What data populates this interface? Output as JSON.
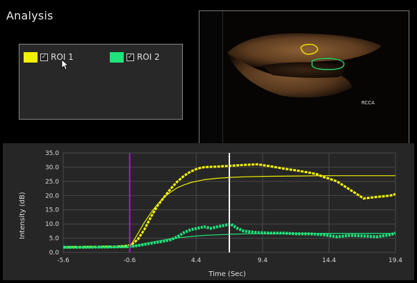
{
  "app": {
    "title": "Analysis"
  },
  "roi_panel": {
    "items": [
      {
        "label": "ROI 1",
        "color": "#f2f200",
        "checked": true
      },
      {
        "label": "ROI 2",
        "color": "#1ee37a",
        "checked": true
      }
    ]
  },
  "ultrasound": {
    "label": "RCCA"
  },
  "colors": {
    "roi1": "#f2f200",
    "roi2": "#1ee37a",
    "marker_injection": "#b012d6",
    "marker_cursor": "#ffffff",
    "grid": "#4a4a4a"
  },
  "chart_data": {
    "type": "line",
    "xlabel": "Time (Sec)",
    "ylabel": "Intensity (dB)",
    "xlim": [
      -5.6,
      19.4
    ],
    "ylim": [
      0,
      35
    ],
    "xticks": [
      "-5.6",
      "-0.6",
      "4.4",
      "9.4",
      "14.4",
      "19.4"
    ],
    "yticks": [
      "0.0",
      "5.0",
      "10.0",
      "15.0",
      "20.0",
      "25.0",
      "30.0",
      "35.0"
    ],
    "grid": true,
    "markers": [
      {
        "name": "injection",
        "x": -0.6
      },
      {
        "name": "cursor",
        "x": 6.9
      }
    ],
    "series": [
      {
        "name": "ROI 1",
        "x": [
          -5.6,
          -4.0,
          -2.0,
          -1.0,
          -0.5,
          0.0,
          0.5,
          1.0,
          1.5,
          2.0,
          2.5,
          3.0,
          3.5,
          4.0,
          4.5,
          5.0,
          6.0,
          7.0,
          8.0,
          9.0,
          10.0,
          11.0,
          12.0,
          13.0,
          13.5,
          14.0,
          14.4,
          15.0,
          15.5,
          16.0,
          16.5,
          17.0,
          18.0,
          19.0,
          19.4
        ],
        "y": [
          1.8,
          1.9,
          2.0,
          2.2,
          2.6,
          4.5,
          8.0,
          12.5,
          16.5,
          19.5,
          22.5,
          25.0,
          27.0,
          28.5,
          29.5,
          30.0,
          30.2,
          30.5,
          30.8,
          31.0,
          30.3,
          29.5,
          28.8,
          28.0,
          27.5,
          26.5,
          26.0,
          25.0,
          23.5,
          22.0,
          20.5,
          19.0,
          19.5,
          20.0,
          20.5
        ]
      },
      {
        "name": "ROI 1 fit",
        "x": [
          -5.6,
          -0.6,
          0.0,
          0.5,
          1.0,
          1.5,
          2.0,
          2.5,
          3.0,
          3.5,
          4.0,
          5.0,
          6.0,
          7.0,
          8.0,
          10.0,
          12.0,
          14.0,
          16.0,
          19.4
        ],
        "y": [
          1.8,
          1.8,
          6.5,
          10.5,
          14.0,
          17.0,
          19.5,
          21.3,
          22.8,
          23.8,
          24.6,
          25.6,
          26.1,
          26.4,
          26.6,
          26.8,
          26.9,
          27.0,
          27.0,
          27.0
        ]
      },
      {
        "name": "ROI 2",
        "x": [
          -5.6,
          -4.0,
          -2.0,
          -1.0,
          -0.5,
          0.0,
          0.5,
          1.0,
          1.5,
          2.0,
          2.5,
          3.0,
          3.5,
          4.0,
          4.5,
          5.0,
          5.5,
          6.0,
          6.5,
          7.0,
          7.5,
          8.0,
          9.0,
          10.0,
          11.0,
          12.0,
          13.0,
          14.0,
          15.0,
          16.0,
          17.0,
          18.0,
          19.0,
          19.4
        ],
        "y": [
          1.8,
          1.8,
          1.9,
          2.0,
          2.1,
          2.4,
          2.8,
          3.2,
          3.6,
          4.0,
          4.5,
          5.5,
          7.0,
          8.0,
          8.5,
          9.0,
          8.5,
          9.0,
          9.5,
          10.0,
          8.5,
          7.5,
          7.0,
          6.8,
          6.8,
          6.5,
          6.5,
          6.2,
          5.5,
          6.0,
          5.8,
          5.5,
          6.2,
          6.8
        ]
      },
      {
        "name": "ROI 2 fit",
        "x": [
          -5.6,
          -0.6,
          0.0,
          1.0,
          2.0,
          3.0,
          4.0,
          5.0,
          6.0,
          7.0,
          8.0,
          10.0,
          12.0,
          14.0,
          16.0,
          19.4
        ],
        "y": [
          1.8,
          1.8,
          2.5,
          3.5,
          4.4,
          5.1,
          5.6,
          6.0,
          6.2,
          6.4,
          6.5,
          6.6,
          6.7,
          6.7,
          6.7,
          6.7
        ]
      }
    ]
  }
}
